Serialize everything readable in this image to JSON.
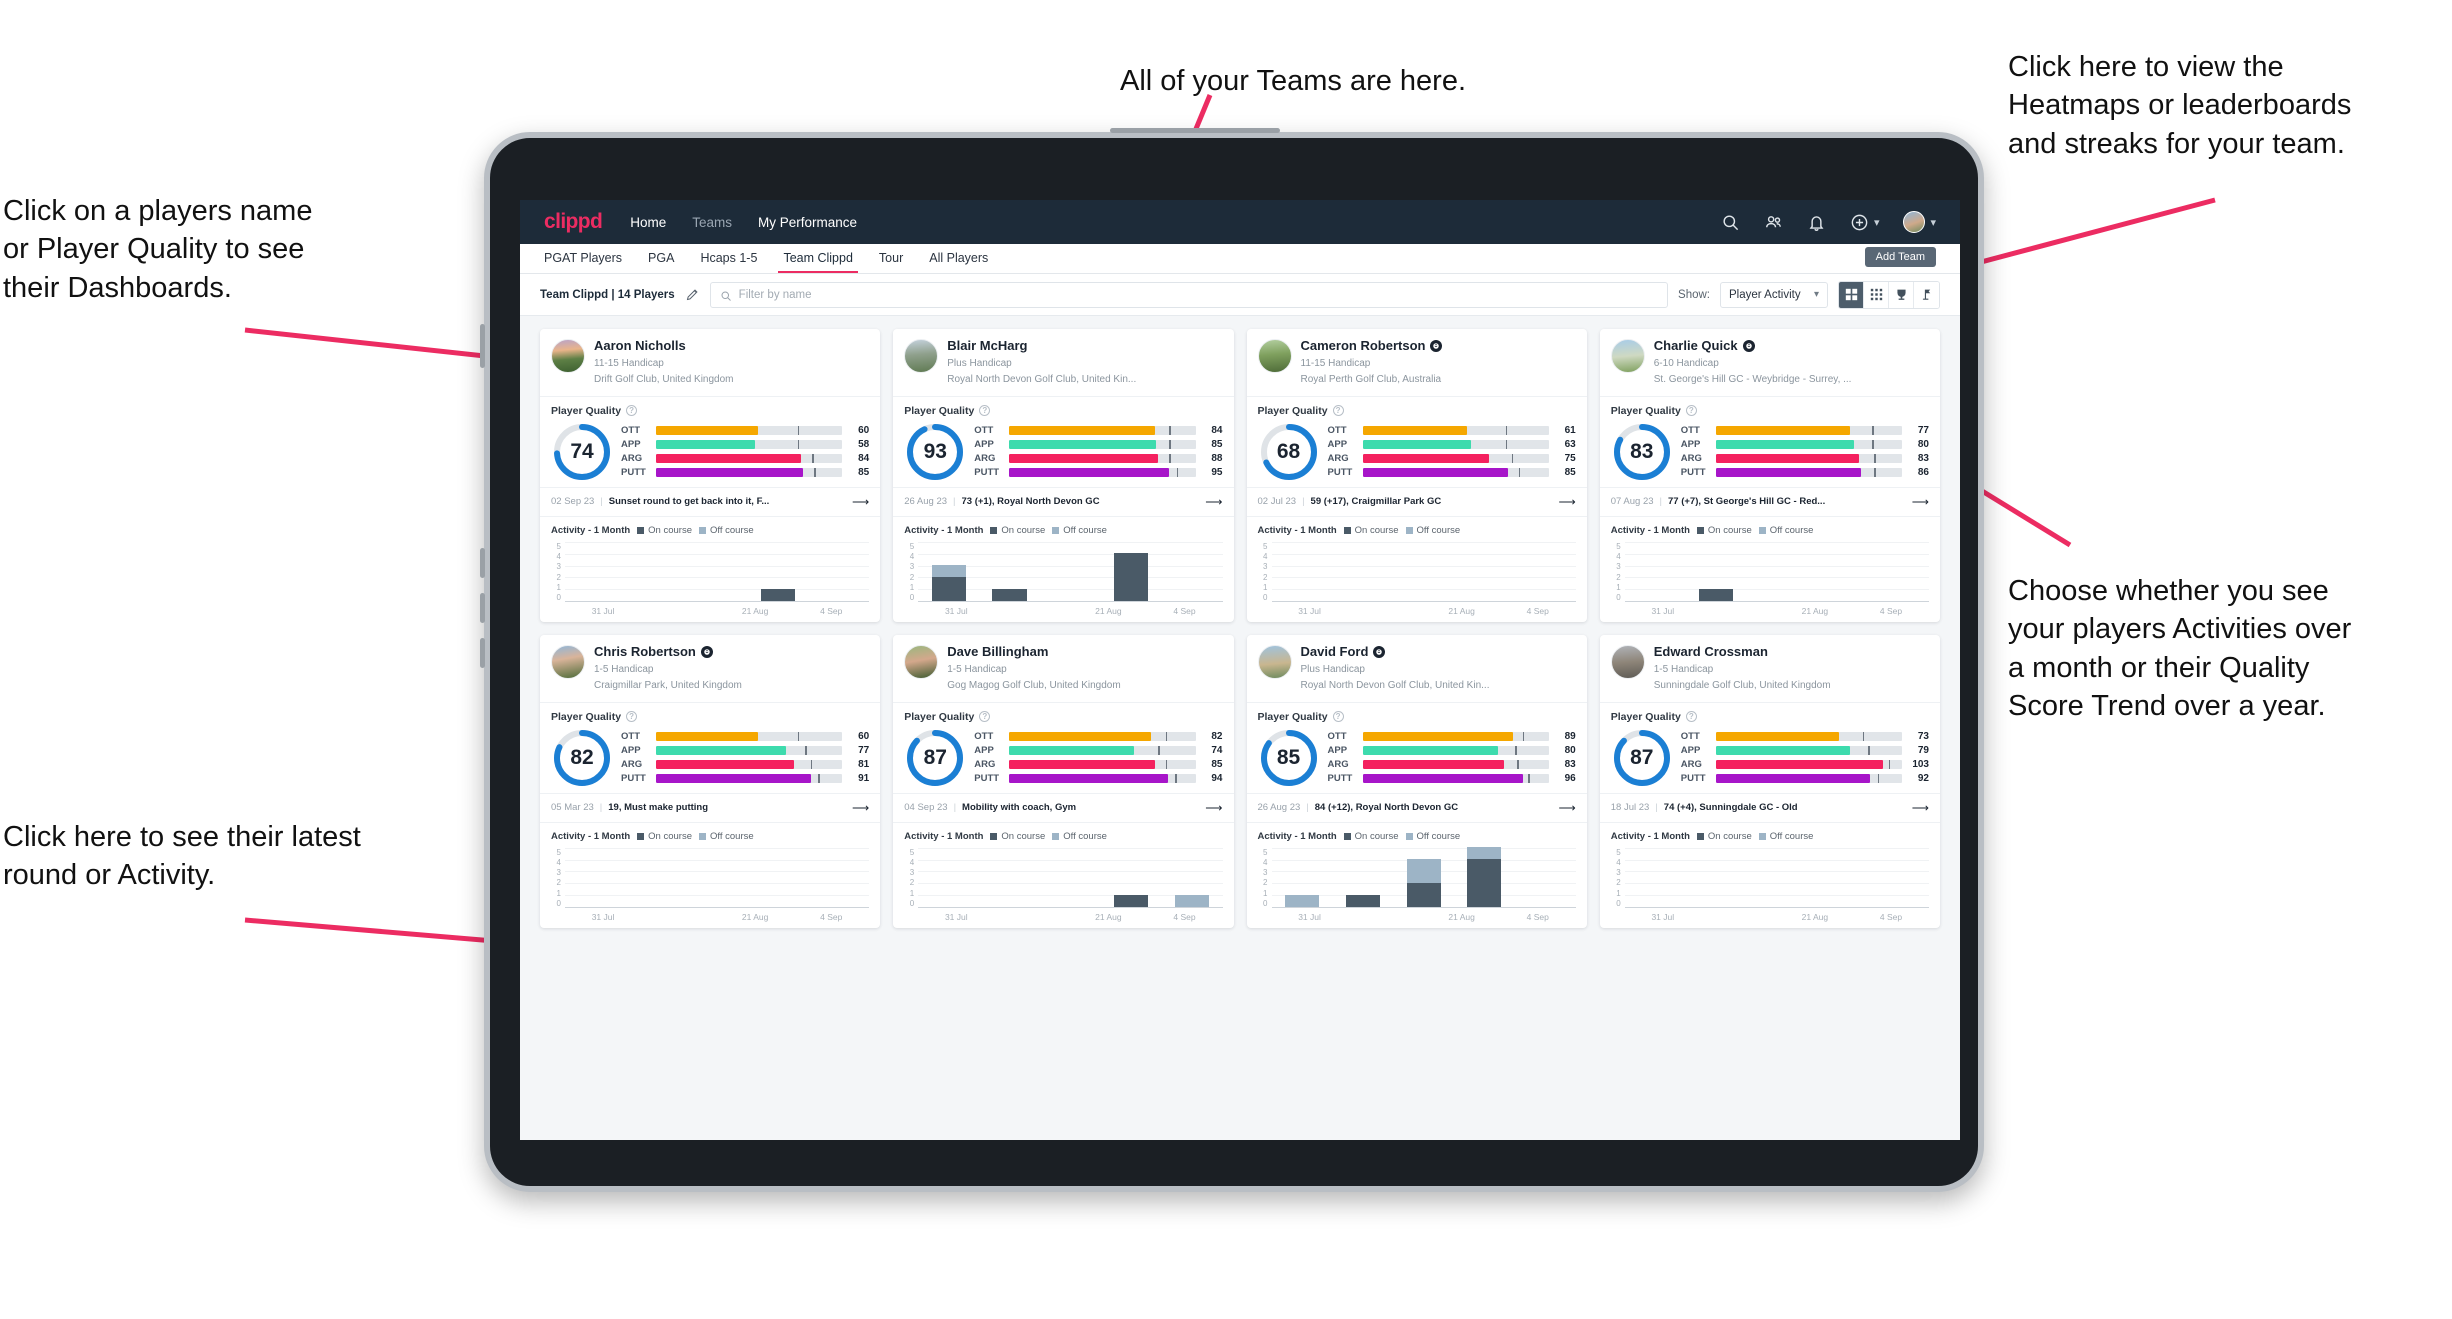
{
  "annotations": {
    "top": "All of your Teams are here.",
    "top_right": "Click here to view the\nHeatmaps or leaderboards\nand streaks for your team.",
    "left": "Click on a players name\nor Player Quality to see\ntheir Dashboards.",
    "right": "Choose whether you see\nyour players Activities over\na month or their Quality\nScore Trend over a year.",
    "bottom_left": "Click here to see their latest\nround or Activity."
  },
  "colors": {
    "brand_pink": "#ec2c62",
    "navbar": "#1d2b39",
    "ring_blue": "#1b7fd4",
    "ott": "#f5a700",
    "app": "#3ddbad",
    "arg": "#f4215f",
    "putt": "#a715c9",
    "on_course": "#4a5a67",
    "off_course": "#9db4c6"
  },
  "navbar": {
    "logo": "clippd",
    "links": [
      {
        "label": "Home",
        "active": true
      },
      {
        "label": "Teams",
        "active": false
      },
      {
        "label": "My Performance",
        "active": true
      }
    ],
    "icons": [
      "search-icon",
      "people-icon",
      "bell-icon",
      "plus-circle-icon",
      "avatar"
    ]
  },
  "tabs": [
    {
      "label": "PGAT Players",
      "active": false
    },
    {
      "label": "PGA",
      "active": false
    },
    {
      "label": "Hcaps 1-5",
      "active": false
    },
    {
      "label": "Team Clippd",
      "active": true
    },
    {
      "label": "Tour",
      "active": false
    },
    {
      "label": "All Players",
      "active": false
    }
  ],
  "add_team_button": "Add Team",
  "toolbar": {
    "team_label": "Team Clippd | 14 Players",
    "edit_icon": "pencil-icon",
    "search_placeholder": "Filter by name",
    "show_label": "Show:",
    "show_value": "Player Activity",
    "view_buttons": [
      "grid-large-icon",
      "grid-small-icon",
      "trophy-icon",
      "flag-icon"
    ],
    "active_view": 0
  },
  "chart_data": {
    "type": "bar",
    "title": "Activity - 1 Month",
    "categories": [
      "31 Jul",
      "",
      "21 Aug",
      "4 Sep"
    ],
    "ylim": [
      0,
      5
    ],
    "yticks": [
      5,
      4,
      3,
      2,
      1,
      0
    ],
    "legend": [
      "On course",
      "Off course"
    ],
    "legend_position": "top",
    "grid": true,
    "series_per_player": [
      {
        "player": "Aaron Nicholls",
        "on_course": [
          0,
          0,
          0,
          1,
          0
        ],
        "off_course": [
          0,
          0,
          0,
          0,
          0
        ]
      },
      {
        "player": "Blair McHarg",
        "on_course": [
          2,
          1,
          0,
          4,
          0
        ],
        "off_course": [
          1,
          0,
          0,
          0,
          0
        ]
      },
      {
        "player": "Cameron Robertson",
        "on_course": [
          0,
          0,
          0,
          0,
          0
        ],
        "off_course": [
          0,
          0,
          0,
          0,
          0
        ]
      },
      {
        "player": "Charlie Quick",
        "on_course": [
          0,
          1,
          0,
          0,
          0
        ],
        "off_course": [
          0,
          0,
          0,
          0,
          0
        ]
      },
      {
        "player": "Chris Robertson",
        "on_course": [
          0,
          0,
          0,
          0,
          0
        ],
        "off_course": [
          0,
          0,
          0,
          0,
          0
        ]
      },
      {
        "player": "Dave Billingham",
        "on_course": [
          0,
          0,
          0,
          1,
          0
        ],
        "off_course": [
          0,
          0,
          0,
          0,
          1
        ]
      },
      {
        "player": "David Ford",
        "on_course": [
          0,
          1,
          2,
          4,
          0
        ],
        "off_course": [
          1,
          0,
          2,
          1,
          0
        ]
      },
      {
        "player": "Edward Crossman",
        "on_course": [
          0,
          0,
          0,
          0,
          0
        ],
        "off_course": [
          0,
          0,
          0,
          0,
          0
        ]
      }
    ]
  },
  "cards": [
    {
      "name": "Aaron Nicholls",
      "verified": false,
      "handicap": "11-15 Handicap",
      "club": "Drift Golf Club, United Kingdom",
      "quality_title": "Player Quality",
      "score": 74,
      "metrics": [
        {
          "label": "OTT",
          "value": 60,
          "fill": 55,
          "tick": 76
        },
        {
          "label": "APP",
          "value": 58,
          "fill": 53,
          "tick": 76
        },
        {
          "label": "ARG",
          "value": 84,
          "fill": 78,
          "tick": 84
        },
        {
          "label": "PUTT",
          "value": 85,
          "fill": 79,
          "tick": 85
        }
      ],
      "latest_date": "02 Sep 23",
      "latest_desc": "Sunset round to get back into it, F...",
      "activity_title": "Activity - 1 Month",
      "on_course": [
        0,
        0,
        0,
        1,
        0
      ],
      "off_course": [
        0,
        0,
        0,
        0,
        0
      ]
    },
    {
      "name": "Blair McHarg",
      "verified": false,
      "handicap": "Plus Handicap",
      "club": "Royal North Devon Golf Club, United Kin...",
      "quality_title": "Player Quality",
      "score": 93,
      "metrics": [
        {
          "label": "OTT",
          "value": 84,
          "fill": 78,
          "tick": 86
        },
        {
          "label": "APP",
          "value": 85,
          "fill": 79,
          "tick": 86
        },
        {
          "label": "ARG",
          "value": 88,
          "fill": 80,
          "tick": 86
        },
        {
          "label": "PUTT",
          "value": 95,
          "fill": 86,
          "tick": 90
        }
      ],
      "latest_date": "26 Aug 23",
      "latest_desc": "73 (+1), Royal North Devon GC",
      "activity_title": "Activity - 1 Month",
      "on_course": [
        2,
        1,
        0,
        4,
        0
      ],
      "off_course": [
        1,
        0,
        0,
        0,
        0
      ]
    },
    {
      "name": "Cameron Robertson",
      "verified": true,
      "handicap": "11-15 Handicap",
      "club": "Royal Perth Golf Club, Australia",
      "quality_title": "Player Quality",
      "score": 68,
      "metrics": [
        {
          "label": "OTT",
          "value": 61,
          "fill": 56,
          "tick": 77
        },
        {
          "label": "APP",
          "value": 63,
          "fill": 58,
          "tick": 77
        },
        {
          "label": "ARG",
          "value": 75,
          "fill": 68,
          "tick": 80
        },
        {
          "label": "PUTT",
          "value": 85,
          "fill": 78,
          "tick": 84
        }
      ],
      "latest_date": "02 Jul 23",
      "latest_desc": "59 (+17), Craigmillar Park GC",
      "activity_title": "Activity - 1 Month",
      "on_course": [
        0,
        0,
        0,
        0,
        0
      ],
      "off_course": [
        0,
        0,
        0,
        0,
        0
      ]
    },
    {
      "name": "Charlie Quick",
      "verified": true,
      "handicap": "6-10 Handicap",
      "club": "St. George's Hill GC - Weybridge - Surrey, ...",
      "quality_title": "Player Quality",
      "score": 83,
      "metrics": [
        {
          "label": "OTT",
          "value": 77,
          "fill": 72,
          "tick": 84
        },
        {
          "label": "APP",
          "value": 80,
          "fill": 74,
          "tick": 84
        },
        {
          "label": "ARG",
          "value": 83,
          "fill": 77,
          "tick": 85
        },
        {
          "label": "PUTT",
          "value": 86,
          "fill": 78,
          "tick": 85
        }
      ],
      "latest_date": "07 Aug 23",
      "latest_desc": "77 (+7), St George's Hill GC - Red...",
      "activity_title": "Activity - 1 Month",
      "on_course": [
        0,
        1,
        0,
        0,
        0
      ],
      "off_course": [
        0,
        0,
        0,
        0,
        0
      ]
    },
    {
      "name": "Chris Robertson",
      "verified": true,
      "handicap": "1-5 Handicap",
      "club": "Craigmillar Park, United Kingdom",
      "quality_title": "Player Quality",
      "score": 82,
      "metrics": [
        {
          "label": "OTT",
          "value": 60,
          "fill": 55,
          "tick": 76
        },
        {
          "label": "APP",
          "value": 77,
          "fill": 70,
          "tick": 80
        },
        {
          "label": "ARG",
          "value": 81,
          "fill": 74,
          "tick": 83
        },
        {
          "label": "PUTT",
          "value": 91,
          "fill": 83,
          "tick": 87
        }
      ],
      "latest_date": "05 Mar 23",
      "latest_desc": "19, Must make putting",
      "activity_title": "Activity - 1 Month",
      "on_course": [
        0,
        0,
        0,
        0,
        0
      ],
      "off_course": [
        0,
        0,
        0,
        0,
        0
      ]
    },
    {
      "name": "Dave Billingham",
      "verified": false,
      "handicap": "1-5 Handicap",
      "club": "Gog Magog Golf Club, United Kingdom",
      "quality_title": "Player Quality",
      "score": 87,
      "metrics": [
        {
          "label": "OTT",
          "value": 82,
          "fill": 76,
          "tick": 84
        },
        {
          "label": "APP",
          "value": 74,
          "fill": 67,
          "tick": 80
        },
        {
          "label": "ARG",
          "value": 85,
          "fill": 78,
          "tick": 84
        },
        {
          "label": "PUTT",
          "value": 94,
          "fill": 85,
          "tick": 89
        }
      ],
      "latest_date": "04 Sep 23",
      "latest_desc": "Mobility with coach, Gym",
      "activity_title": "Activity - 1 Month",
      "on_course": [
        0,
        0,
        0,
        1,
        0
      ],
      "off_course": [
        0,
        0,
        0,
        0,
        1
      ]
    },
    {
      "name": "David Ford",
      "verified": true,
      "handicap": "Plus Handicap",
      "club": "Royal North Devon Golf Club, United Kin...",
      "quality_title": "Player Quality",
      "score": 85,
      "metrics": [
        {
          "label": "OTT",
          "value": 89,
          "fill": 81,
          "tick": 86
        },
        {
          "label": "APP",
          "value": 80,
          "fill": 73,
          "tick": 82
        },
        {
          "label": "ARG",
          "value": 83,
          "fill": 76,
          "tick": 83
        },
        {
          "label": "PUTT",
          "value": 96,
          "fill": 86,
          "tick": 89
        }
      ],
      "latest_date": "26 Aug 23",
      "latest_desc": "84 (+12), Royal North Devon GC",
      "activity_title": "Activity - 1 Month",
      "on_course": [
        0,
        1,
        2,
        4,
        0
      ],
      "off_course": [
        1,
        0,
        2,
        1,
        0
      ]
    },
    {
      "name": "Edward Crossman",
      "verified": false,
      "handicap": "1-5 Handicap",
      "club": "Sunningdale Golf Club, United Kingdom",
      "quality_title": "Player Quality",
      "score": 87,
      "metrics": [
        {
          "label": "OTT",
          "value": 73,
          "fill": 66,
          "tick": 79
        },
        {
          "label": "APP",
          "value": 79,
          "fill": 72,
          "tick": 82
        },
        {
          "label": "ARG",
          "value": 103,
          "fill": 90,
          "tick": 93
        },
        {
          "label": "PUTT",
          "value": 92,
          "fill": 83,
          "tick": 87
        }
      ],
      "latest_date": "18 Jul 23",
      "latest_desc": "74 (+4), Sunningdale GC - Old",
      "activity_title": "Activity - 1 Month",
      "on_course": [
        0,
        0,
        0,
        0,
        0
      ],
      "off_course": [
        0,
        0,
        0,
        0,
        0
      ]
    }
  ]
}
